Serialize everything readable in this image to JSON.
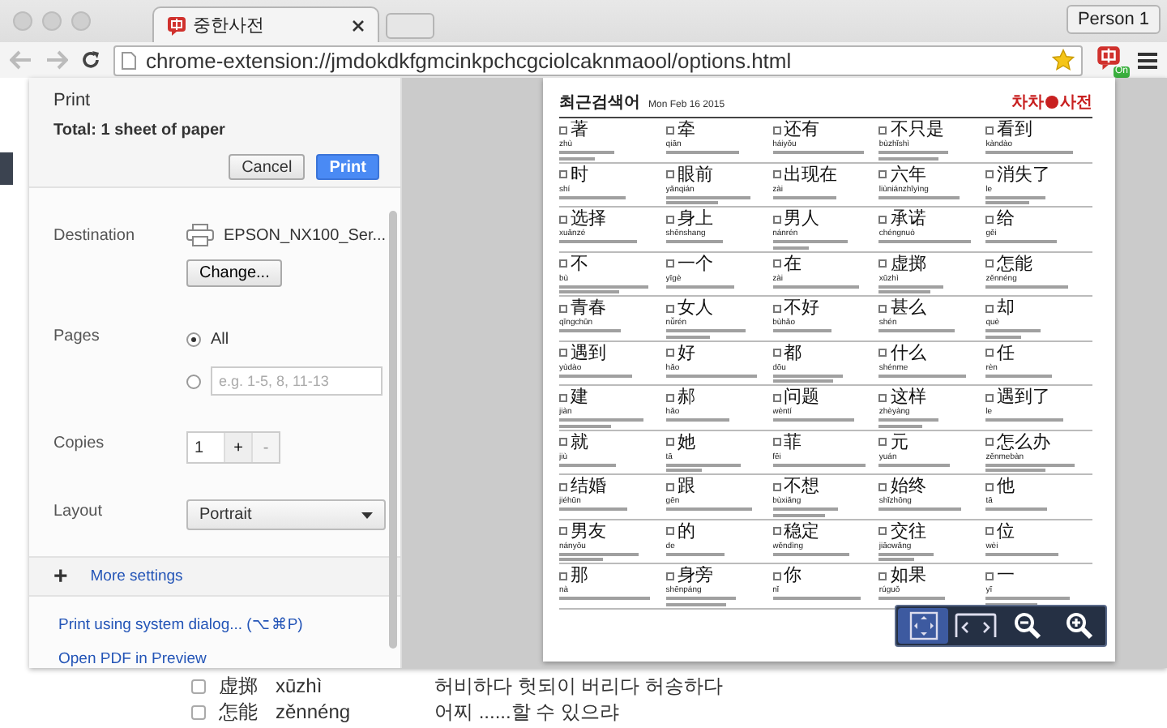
{
  "browser": {
    "tab_title": "중한사전",
    "profile": "Person 1",
    "url": "chrome-extension://jmdokdkfgmcinkpchcgciolcaknmaool/options.html",
    "extension_badge": "On"
  },
  "print": {
    "title": "Print",
    "total": "Total: 1 sheet of paper",
    "buttons": [
      {
        "label": "Cancel",
        "kind": "secondary"
      },
      {
        "label": "Print",
        "kind": "primary"
      }
    ],
    "destination": {
      "label": "Destination",
      "printer": "EPSON_NX100_Ser...",
      "change": "Change..."
    },
    "pages": {
      "label": "Pages",
      "options": [
        {
          "label": "All",
          "selected": true
        },
        {
          "placeholder": "e.g. 1-5, 8, 11-13",
          "selected": false
        }
      ]
    },
    "copies": {
      "label": "Copies",
      "value": "1",
      "plus": "+",
      "minus": "-",
      "minus_disabled": true
    },
    "layout": {
      "label": "Layout",
      "value": "Portrait"
    },
    "more_settings": {
      "icon": "+",
      "label": "More settings"
    },
    "links": [
      "Print using system dialog... (⌥⌘P)",
      "Open PDF in Preview"
    ]
  },
  "preview": {
    "title": "최근검색어",
    "date": "Mon Feb 16 2015",
    "logo": [
      "차차",
      "사전"
    ],
    "entries": [
      {
        "word": "著",
        "pinyin": "zhù"
      },
      {
        "word": "牵",
        "pinyin": "qiān"
      },
      {
        "word": "还有",
        "pinyin": "háiyǒu"
      },
      {
        "word": "不只是",
        "pinyin": "bùzhǐshì"
      },
      {
        "word": "看到",
        "pinyin": "kàndào"
      },
      {
        "word": "时",
        "pinyin": "shí"
      },
      {
        "word": "眼前",
        "pinyin": "yǎnqián"
      },
      {
        "word": "出现在",
        "pinyin": "zài"
      },
      {
        "word": "六年",
        "pinyin": "liùniánzhīyìng"
      },
      {
        "word": "消失了",
        "pinyin": "le"
      },
      {
        "word": "选择",
        "pinyin": "xuǎnzé"
      },
      {
        "word": "身上",
        "pinyin": "shēnshang"
      },
      {
        "word": "男人",
        "pinyin": "nánrén"
      },
      {
        "word": "承诺",
        "pinyin": "chéngnuò"
      },
      {
        "word": "给",
        "pinyin": "gěi"
      },
      {
        "word": "不",
        "pinyin": "bù"
      },
      {
        "word": "一个",
        "pinyin": "yīgè"
      },
      {
        "word": "在",
        "pinyin": "zài"
      },
      {
        "word": "虚掷",
        "pinyin": "xūzhì"
      },
      {
        "word": "怎能",
        "pinyin": "zěnnéng"
      },
      {
        "word": "青春",
        "pinyin": "qīngchūn"
      },
      {
        "word": "女人",
        "pinyin": "nǚrén"
      },
      {
        "word": "不好",
        "pinyin": "bùhǎo"
      },
      {
        "word": "甚么",
        "pinyin": "shén"
      },
      {
        "word": "却",
        "pinyin": "què"
      },
      {
        "word": "遇到",
        "pinyin": "yùdào"
      },
      {
        "word": "好",
        "pinyin": "hǎo"
      },
      {
        "word": "都",
        "pinyin": "dōu"
      },
      {
        "word": "什么",
        "pinyin": "shénme"
      },
      {
        "word": "任",
        "pinyin": "rèn"
      },
      {
        "word": "建",
        "pinyin": "jiàn"
      },
      {
        "word": "郝",
        "pinyin": "hǎo"
      },
      {
        "word": "问题",
        "pinyin": "wèntí"
      },
      {
        "word": "这样",
        "pinyin": "zhèyàng"
      },
      {
        "word": "遇到了",
        "pinyin": "le"
      },
      {
        "word": "就",
        "pinyin": "jiù"
      },
      {
        "word": "她",
        "pinyin": "tā"
      },
      {
        "word": "菲",
        "pinyin": "fēi"
      },
      {
        "word": "元",
        "pinyin": "yuán"
      },
      {
        "word": "怎么办",
        "pinyin": "zěnmebàn"
      },
      {
        "word": "结婚",
        "pinyin": "jiéhūn"
      },
      {
        "word": "跟",
        "pinyin": "gēn"
      },
      {
        "word": "不想",
        "pinyin": "bùxiǎng"
      },
      {
        "word": "始终",
        "pinyin": "shǐzhōng"
      },
      {
        "word": "他",
        "pinyin": "tā"
      },
      {
        "word": "男友",
        "pinyin": "nányǒu"
      },
      {
        "word": "的",
        "pinyin": "de"
      },
      {
        "word": "稳定",
        "pinyin": "wěndìng"
      },
      {
        "word": "交往",
        "pinyin": "jiāowǎng"
      },
      {
        "word": "位",
        "pinyin": "wèi"
      },
      {
        "word": "那",
        "pinyin": "nà"
      },
      {
        "word": "身旁",
        "pinyin": "shēnpáng"
      },
      {
        "word": "你",
        "pinyin": "nǐ"
      },
      {
        "word": "如果",
        "pinyin": "rúguǒ"
      },
      {
        "word": "一",
        "pinyin": "yī"
      }
    ],
    "zoom_controls": [
      {
        "kind": "fit",
        "selected": true
      },
      {
        "kind": "pages",
        "selected": false
      },
      {
        "kind": "zoom_out",
        "selected": false
      },
      {
        "kind": "zoom_in",
        "selected": false
      }
    ]
  },
  "background_list": [
    {
      "word": "虚掷",
      "pinyin": "xūzhì",
      "meaning": "허비하다 헛되이 버리다 허송하다",
      "checked": false
    },
    {
      "word": "怎能",
      "pinyin": "zěnnéng",
      "meaning": "어찌 ......할 수 있으랴",
      "checked": false
    }
  ]
}
